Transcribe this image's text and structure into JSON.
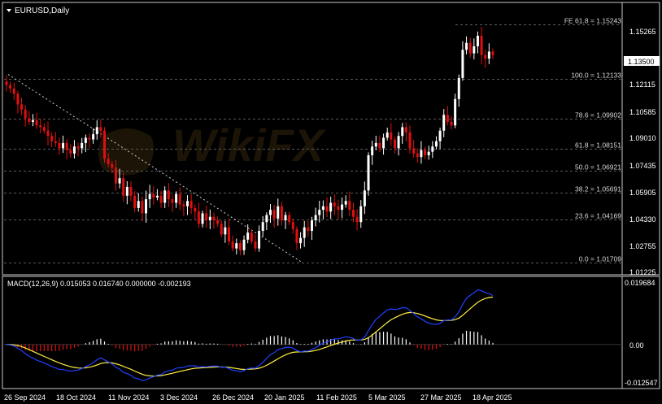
{
  "symbol_label": "EURUSD,Daily",
  "indicator_label": "MACD(12,26,9) 0.015053 0.016740 0.000000 -0.002193",
  "current_price": "1.13500",
  "watermark_text": "WikiFX",
  "colors": {
    "background": "#000000",
    "grid": "#5a5a5a",
    "frame": "#c8c8c8",
    "text": "#ffffff",
    "bull_candle": "#ffffff",
    "bear_candle": "#e01010",
    "macd_line": "#2040ff",
    "signal_line": "#ffee44",
    "hist_positive": "#ffffff",
    "hist_negative": "#e01010",
    "price_tag_bg": "#ffffff",
    "price_tag_text": "#000000",
    "trendline": "#cfcfcf"
  },
  "price_axis": {
    "labels": [
      "1.15265",
      "1.12115",
      "1.10585",
      "1.09010",
      "1.07435",
      "1.05905",
      "1.04330",
      "1.02755",
      "1.01225"
    ]
  },
  "macd_axis": {
    "labels": [
      "0.019684",
      "0.00",
      "-0.012547"
    ]
  },
  "time_axis": {
    "labels": [
      "26 Sep 2024",
      "18 Oct 2024",
      "11 Nov 2024",
      "3 Dec 2024",
      "26 Dec 2024",
      "20 Jan 2025",
      "11 Feb 2025",
      "5 Mar 2025",
      "27 Mar 2025",
      "18 Apr 2025"
    ]
  },
  "fib_levels": [
    {
      "label": "FE 61.8 = 1.15243",
      "value": 1.15243
    },
    {
      "label": "100.0 = 1.12133",
      "value": 1.12133
    },
    {
      "label": "78.6 = 1.09902",
      "value": 1.09902
    },
    {
      "label": "61.8 = 1.08151",
      "value": 1.08151
    },
    {
      "label": "50.0 = 1.06921",
      "value": 1.06921
    },
    {
      "label": "38.2 = 1.05691",
      "value": 1.05691
    },
    {
      "label": "23.6 = 1.04169",
      "value": 1.04169
    },
    {
      "label": "0.0 = 1.01709",
      "value": 1.01709
    }
  ],
  "chart_data": [
    {
      "type": "candlestick",
      "title": "EURUSD,Daily",
      "ylim": [
        1.0105,
        1.1645
      ],
      "x_start": "2024-09-26",
      "x_end": "2025-04-23",
      "close_series": [
        1.118,
        1.116,
        1.113,
        1.107,
        1.104,
        1.099,
        1.097,
        1.098,
        1.095,
        1.094,
        1.092,
        1.089,
        1.086,
        1.085,
        1.082,
        1.085,
        1.081,
        1.079,
        1.083,
        1.082,
        1.085,
        1.088,
        1.087,
        1.09,
        1.094,
        1.092,
        1.076,
        1.073,
        1.071,
        1.062,
        1.065,
        1.055,
        1.06,
        1.055,
        1.048,
        1.052,
        1.045,
        1.053,
        1.056,
        1.054,
        1.055,
        1.051,
        1.058,
        1.053,
        1.051,
        1.056,
        1.05,
        1.049,
        1.052,
        1.048,
        1.046,
        1.039,
        1.045,
        1.041,
        1.043,
        1.041,
        1.039,
        1.033,
        1.037,
        1.029,
        1.025,
        1.028,
        1.024,
        1.03,
        1.034,
        1.029,
        1.025,
        1.035,
        1.04,
        1.044,
        1.047,
        1.042,
        1.049,
        1.041,
        1.044,
        1.04,
        1.036,
        1.028,
        1.031,
        1.037,
        1.035,
        1.041,
        1.044,
        1.047,
        1.049,
        1.046,
        1.051,
        1.049,
        1.047,
        1.05,
        1.052,
        1.047,
        1.043,
        1.04,
        1.049,
        1.058,
        1.078,
        1.083,
        1.085,
        1.082,
        1.088,
        1.091,
        1.087,
        1.082,
        1.089,
        1.094,
        1.091,
        1.082,
        1.079,
        1.077,
        1.081,
        1.078,
        1.08,
        1.083,
        1.086,
        1.092,
        1.101,
        1.097,
        1.095,
        1.11,
        1.122,
        1.138,
        1.142,
        1.136,
        1.14,
        1.146,
        1.135,
        1.133,
        1.137,
        1.135
      ]
    },
    {
      "type": "macd",
      "title": "MACD(12,26,9)",
      "series": [
        {
          "name": "MACD",
          "values": [
            0.015053
          ]
        },
        {
          "name": "Signal",
          "values": [
            0.01674
          ]
        }
      ],
      "ylim": [
        -0.012547,
        0.019684
      ]
    }
  ]
}
